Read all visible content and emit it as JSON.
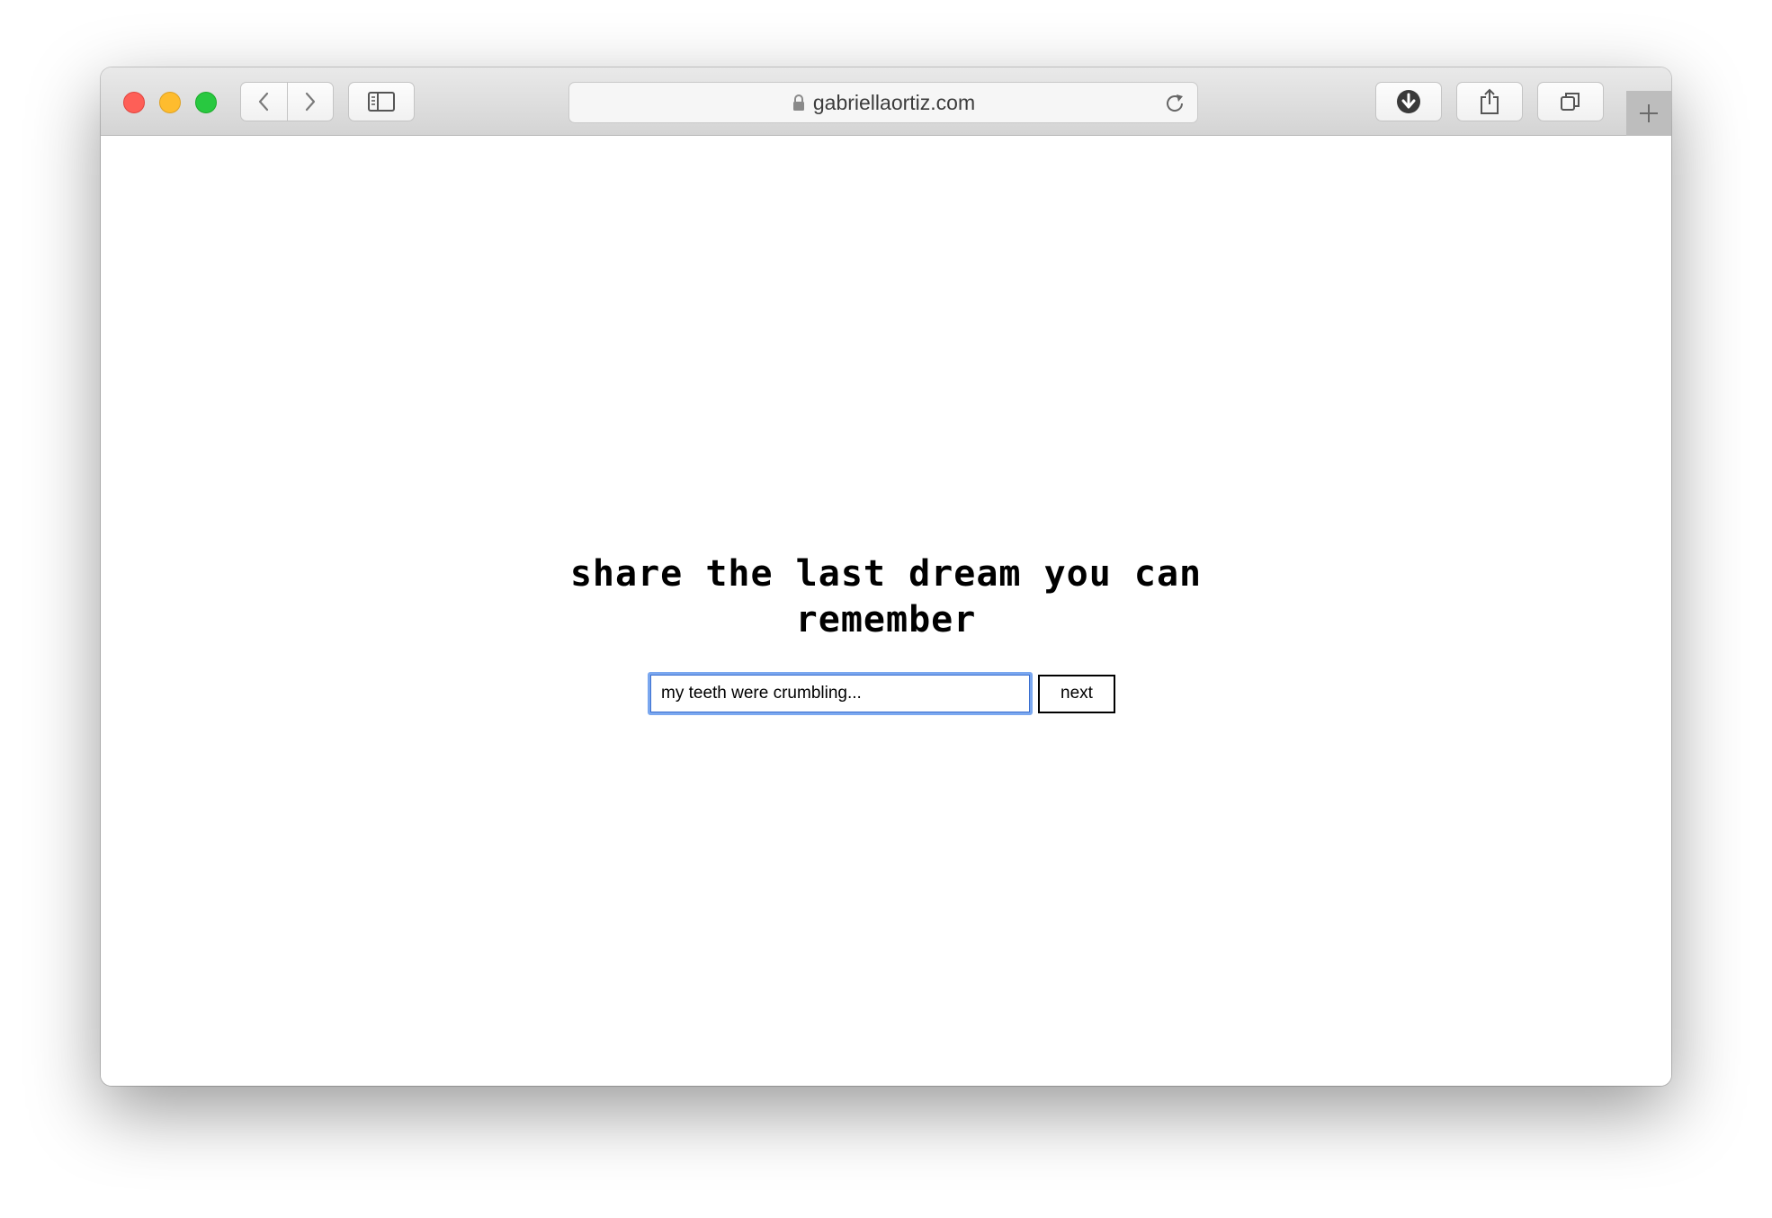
{
  "browser": {
    "url": "gabriellaortiz.com"
  },
  "page": {
    "heading_line1": "share the last dream you can",
    "heading_line2": "remember",
    "input_value": "my teeth were crumbling...",
    "next_label": "next"
  },
  "icons": {
    "close": "close-light-icon",
    "minimize": "minimize-light-icon",
    "zoom": "zoom-light-icon",
    "back": "chevron-left-icon",
    "forward": "chevron-right-icon",
    "sidebar": "sidebar-icon",
    "lock": "lock-icon",
    "reload": "reload-icon",
    "downloads": "download-icon",
    "share": "share-icon",
    "tabs": "tabs-overview-icon",
    "new_tab": "plus-icon"
  },
  "colors": {
    "close": "#fe5f57",
    "minimize": "#febc2e",
    "zoom": "#28c840",
    "input_focus": "#7aa7ef"
  }
}
